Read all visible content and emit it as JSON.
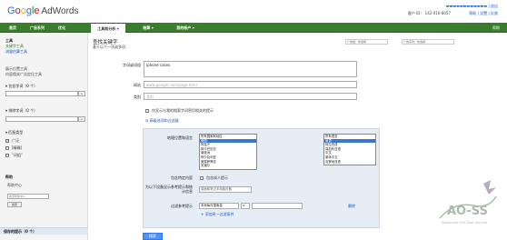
{
  "header": {
    "logo_letters": [
      "G",
      "o",
      "o",
      "g",
      "l",
      "e"
    ],
    "logo_product": "AdWords",
    "customer_id": "客户 ID： 142-016-8057",
    "account_email": "▬▬▬▬▬▬▬▬▬▬▬▬ | 退出",
    "links": "帮助 | 设置 | 反馈"
  },
  "nav": {
    "items": [
      "首页",
      "广告系列",
      "优化",
      "工具和分析 ▾",
      "结算 ▾",
      "我的帐户 ▾"
    ],
    "right_label": "帮助"
  },
  "sidebar": {
    "tools_heading": "工具",
    "tool_links": [
      "关键字工具",
      "流量估算工具"
    ],
    "other_tools": [
      "展示位置工具",
      "内容相关广告定位工具"
    ],
    "include_terms_label": "▾ 包含字词（0 个）",
    "exclude_terms_label": "▾ 排除字词（0 个）",
    "match_types_label": "▾ 匹配类型",
    "match_types": [
      {
        "label": "广泛",
        "checked": true
      },
      {
        "label": "[精确]",
        "checked": false
      },
      {
        "label": "\"词组\"",
        "checked": false
      }
    ],
    "help_heading": "帮助",
    "help_center": "帮助中心",
    "help_search_placeholder": "搜索帮助中心",
    "help_search_button": "搜索",
    "saved_ideas": "保存的提示（0 个）"
  },
  "main": {
    "title": "查找关键字",
    "subtitle": "基于以下一项或多项：",
    "top_fields": [
      "广告组：未选择",
      "广告系列：未选择"
    ],
    "keyword_label": "字词或词组",
    "keyword_value": "iphone cases",
    "website_label": "网站",
    "website_placeholder": "www.google.com/page.html",
    "category_label": "类别",
    "category_placeholder": "类别",
    "only_closely_related": "仅显示与我的搜索字词密切相关的提示",
    "advanced_toggle": "⊟ 高级选项和过滤器",
    "loc_lang_label": "地理位置和语言",
    "locations": [
      "所有国家和地区",
      "美国",
      "阿富汗",
      "阿尔巴尼亚",
      "南极洲",
      "阿尔及利亚",
      "美属萨摩亚",
      "安道尔"
    ],
    "selected_location": "美国",
    "languages": [
      "所有语言",
      "英语",
      "阿拉伯语",
      "保加利亚语",
      "中文",
      "繁体中文",
      "克罗地亚语"
    ],
    "selected_language": "英语",
    "adult_label": "包含特定内容",
    "adult_checkbox": "包含成人提示",
    "device_label": "为以下设备显示参考提示和统计信息",
    "device_value": "桌面和笔记本电脑设备",
    "filter_label": "过滤参考提示",
    "filter_select": "本地每月搜索量",
    "filter_operator": "≥",
    "delete_link": "删除",
    "add_filter": "+ 添加另一过滤条件",
    "search_button": "搜索"
  },
  "watermark": {
    "text": "AO-SS",
    "sub": "Advanced One-Stop Service"
  },
  "colors": {
    "nav_green": "#3a7d2c",
    "link_blue": "#1155cc",
    "adv_bg": "#e6edf5",
    "highlight": "#3875d7"
  }
}
